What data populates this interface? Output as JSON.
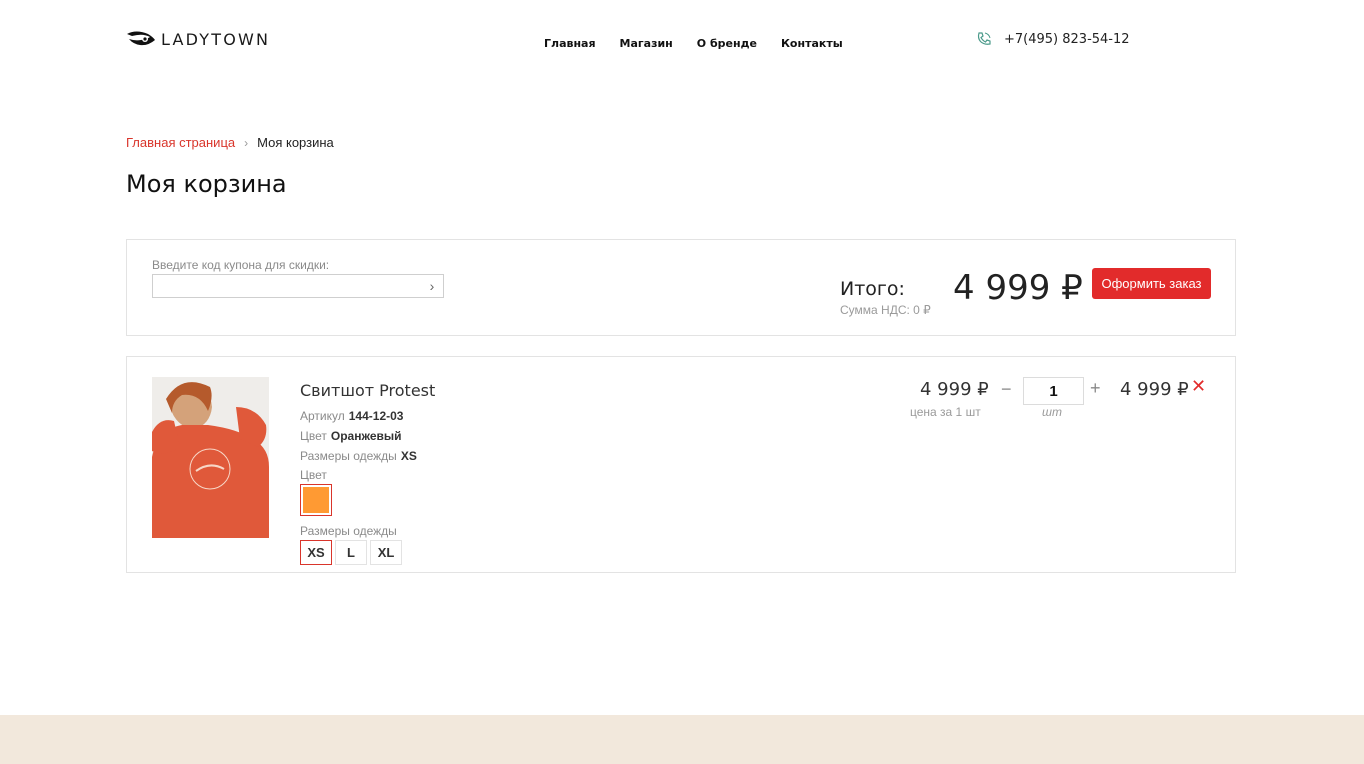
{
  "header": {
    "logo_text": "LADYTOWN",
    "nav": [
      "Главная",
      "Магазин",
      "О бренде",
      "Контакты"
    ],
    "phone": "+7(495) 823-54-12"
  },
  "breadcrumb": {
    "home": "Главная страница",
    "separator": "›",
    "current": "Моя корзина"
  },
  "page_title": "Моя корзина",
  "summary": {
    "coupon_label": "Введите код купона для скидки:",
    "coupon_value": "",
    "coupon_button": "›",
    "total_label": "Итого:",
    "vat": "Сумма НДС: 0 ₽",
    "total_value": "4 999 ₽",
    "checkout_label": "Оформить заказ"
  },
  "item": {
    "name": "Свитшот Protest",
    "article_label": "Артикул",
    "article_value": "144-12-03",
    "color_label": "Цвет",
    "color_value": "Оранжевый",
    "size_label": "Размеры одежды",
    "size_value": "XS",
    "color_picker_label": "Цвет",
    "color_swatch": "#ff9a33",
    "size_picker_label": "Размеры одежды",
    "sizes": [
      "XS",
      "L",
      "XL"
    ],
    "selected_size": "XS",
    "unit_price": "4 999 ₽",
    "unit_note": "цена за 1 шт",
    "qty_minus": "−",
    "quantity": "1",
    "qty_plus": "+",
    "qty_unit": "шт",
    "line_total": "4 999 ₽",
    "remove": "✕"
  },
  "colors": {
    "accent": "#e22b2b",
    "link": "#d9352b",
    "footer_bg": "#f2e8dc",
    "border": "#e3e3e3"
  }
}
